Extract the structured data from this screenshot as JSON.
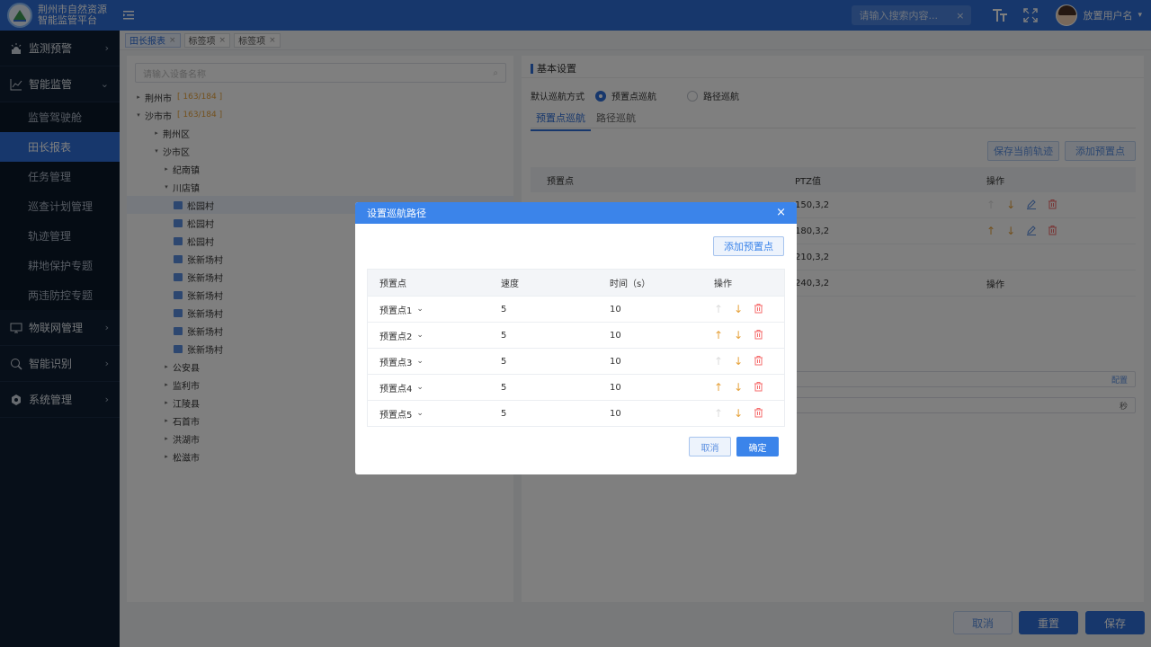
{
  "header": {
    "logo_line1": "荆州市自然资源",
    "logo_line2": "智能监管平台",
    "search_placeholder": "请输入搜索内容...",
    "search_clear": "×",
    "user_name": "放置用户名",
    "user_caret": "▾"
  },
  "sidebar": {
    "groups": [
      {
        "label": "监测预警",
        "arrow": "›"
      },
      {
        "label": "智能监管",
        "arrow": "⌄"
      },
      {
        "label": "物联网管理",
        "arrow": "›"
      },
      {
        "label": "智能识别",
        "arrow": "›"
      },
      {
        "label": "系统管理",
        "arrow": "›"
      }
    ],
    "sub_items": [
      "监管驾驶舱",
      "田长报表",
      "任务管理",
      "巡查计划管理",
      "轨迹管理",
      "耕地保护专题",
      "两违防控专题"
    ]
  },
  "tabs": [
    {
      "label": "田长报表",
      "close": "×"
    },
    {
      "label": "标签项",
      "close": "×"
    },
    {
      "label": "标签项",
      "close": "×"
    }
  ],
  "tree": {
    "search_placeholder": "请输入设备名称",
    "nodes": [
      {
        "label": "荆州市",
        "count": "[ 163/184 ]",
        "toggle": "▸"
      },
      {
        "label": "沙市市",
        "count": "[ 163/184 ]",
        "toggle": "▾"
      },
      {
        "label": "荆州区",
        "toggle": "▸"
      },
      {
        "label": "沙市区",
        "toggle": "▾"
      },
      {
        "label": "纪南镇",
        "toggle": "▸"
      },
      {
        "label": "川店镇",
        "toggle": "▾"
      },
      {
        "label": "松园村"
      },
      {
        "label": "松园村"
      },
      {
        "label": "松园村"
      },
      {
        "label": "张新场村"
      },
      {
        "label": "张新场村"
      },
      {
        "label": "张新场村"
      },
      {
        "label": "张新场村"
      },
      {
        "label": "张新场村"
      },
      {
        "label": "张新场村"
      },
      {
        "label": "公安县",
        "toggle": "▸"
      },
      {
        "label": "监利市",
        "toggle": "▸"
      },
      {
        "label": "江陵县",
        "toggle": "▸"
      },
      {
        "label": "石首市",
        "toggle": "▸"
      },
      {
        "label": "洪湖市",
        "toggle": "▸"
      },
      {
        "label": "松滋市",
        "toggle": "▸"
      }
    ]
  },
  "right": {
    "section_title": "基本设置",
    "mode_label": "默认巡航方式",
    "mode_options": [
      "预置点巡航",
      "路径巡航"
    ],
    "sub_tabs": [
      "预置点巡航",
      "路径巡航"
    ],
    "btn_save_track": "保存当前轨迹",
    "btn_add_preset": "添加预置点",
    "table_headers": [
      "预置点",
      "PTZ值",
      "操作"
    ],
    "rows": [
      {
        "ptz": "150,3,2",
        "ops": ""
      },
      {
        "ptz": "180,3,2",
        "ops": ""
      },
      {
        "ptz": "210,3,2",
        "ops": ""
      },
      {
        "ptz": "240,3,2",
        "ops": "操作"
      }
    ],
    "config_link": "配置",
    "unit_seconds": "秒"
  },
  "bottom": {
    "cancel": "取消",
    "reset": "重置",
    "save": "保存"
  },
  "modal": {
    "title": "设置巡航路径",
    "close": "×",
    "add_preset": "添加预置点",
    "headers": [
      "预置点",
      "速度",
      "时间（s）",
      "操作"
    ],
    "rows": [
      {
        "preset": "预置点1",
        "speed": "5",
        "time": "10"
      },
      {
        "preset": "预置点2",
        "speed": "5",
        "time": "10"
      },
      {
        "preset": "预置点3",
        "speed": "5",
        "time": "10"
      },
      {
        "preset": "预置点4",
        "speed": "5",
        "time": "10"
      },
      {
        "preset": "预置点5",
        "speed": "5",
        "time": "10"
      }
    ],
    "cancel": "取消",
    "ok": "确定"
  },
  "icons": {
    "up": "↑",
    "down": "↓",
    "dropdown": "⌄",
    "search": "⌕"
  },
  "colors": {
    "primary": "#2f6fd8",
    "modal_header": "#3b84ea",
    "sidebar_bg": "#0f1f33",
    "warning": "#e6a23c",
    "danger": "#f56c6c"
  }
}
